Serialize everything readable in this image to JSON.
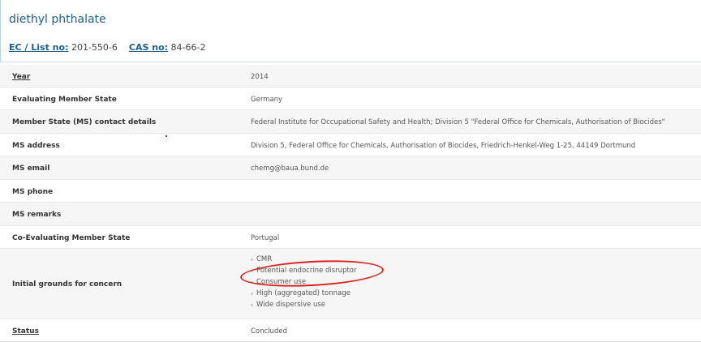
{
  "substance": {
    "name": "diethyl phthalate",
    "ec_label": "EC / List no:",
    "ec_value": "201-550-6",
    "cas_label": "CAS no:",
    "cas_value": "84-66-2"
  },
  "rows": {
    "year": {
      "label": "Year",
      "value": "2014"
    },
    "evaluating_state": {
      "label": "Evaluating Member State",
      "value": "Germany"
    },
    "contact_details": {
      "label": "Member State (MS) contact details",
      "value": "Federal Institute for Occupational Safety and Health; Division 5 \"Federal Office for Chemicals, Authorisation of Biocides\""
    },
    "ms_address": {
      "label": "MS address",
      "value": "Division 5, Federal Office for Chemicals, Authorisation of Biocides, Friedrich-Henkel-Weg 1-25, 44149 Dortmund"
    },
    "ms_email": {
      "label": "MS email",
      "value": "chemg@baua.bund.de"
    },
    "ms_phone": {
      "label": "MS phone",
      "value": ""
    },
    "ms_remarks": {
      "label": "MS remarks",
      "value": ""
    },
    "co_evaluating": {
      "label": "Co-Evaluating Member State",
      "value": "Portugal"
    },
    "grounds": {
      "label": "Initial grounds for concern",
      "items": [
        "CMR",
        "Potential endocrine disruptor",
        "Consumer use",
        "High (aggregated) tonnage",
        "Wide dispersive use"
      ]
    },
    "status": {
      "label": "Status",
      "value": "Concluded"
    }
  },
  "annotation": {
    "highlighted_item": "Potential endocrine disruptor",
    "color": "#d8231f"
  }
}
